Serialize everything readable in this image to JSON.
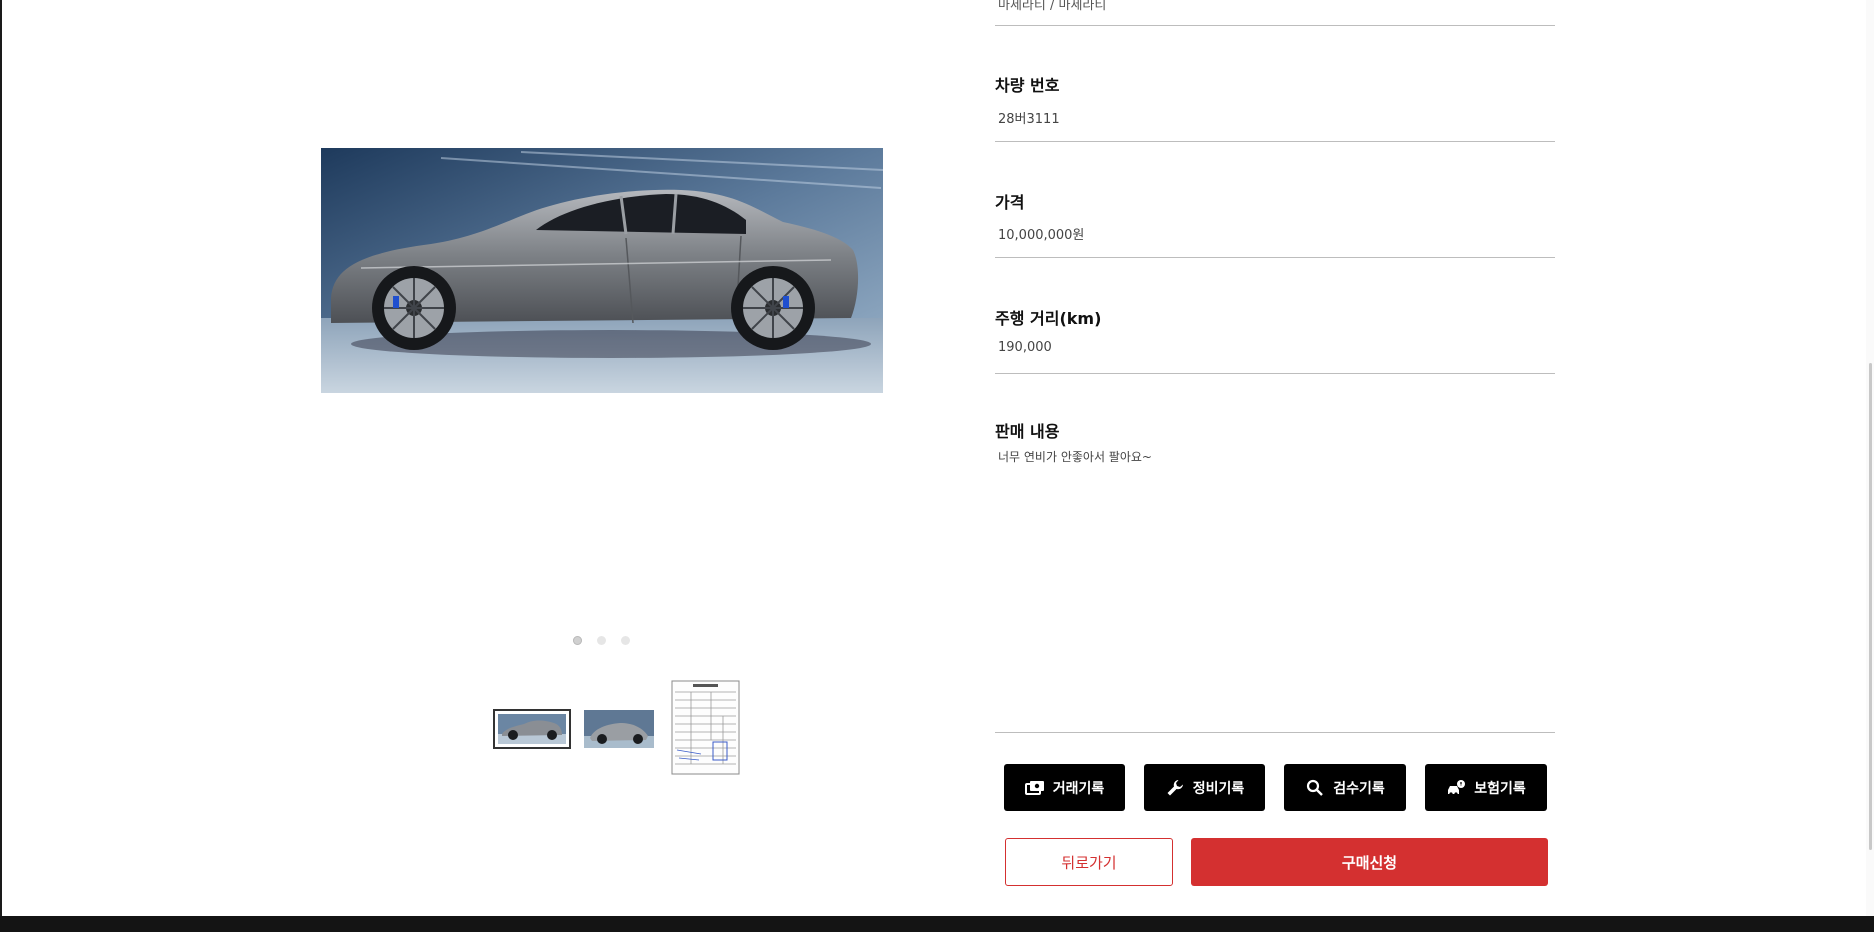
{
  "details": {
    "previous_value": "마세라티 / 마세라티",
    "fields": [
      {
        "label": "차량 번호",
        "value": "28버3111"
      },
      {
        "label": "가격",
        "value": "10,000,000원"
      },
      {
        "label": "주행 거리(km)",
        "value": "190,000"
      }
    ],
    "description_label": "판매 내용",
    "description_text": "너무 연비가 안좋아서 팔아요~"
  },
  "carousel": {
    "slide_count": 3,
    "active_index": 0,
    "thumbnails": [
      {
        "name": "car-side-thumbnail",
        "selected": true
      },
      {
        "name": "car-front-thumbnail",
        "selected": false
      },
      {
        "name": "registration-document-thumbnail",
        "selected": false
      }
    ]
  },
  "record_buttons": [
    {
      "label": "거래기록",
      "icon": "money-icon"
    },
    {
      "label": "정비기록",
      "icon": "wrench-icon"
    },
    {
      "label": "검수기록",
      "icon": "search-icon"
    },
    {
      "label": "보험기록",
      "icon": "insurance-icon"
    }
  ],
  "actions": {
    "back_label": "뒤로가기",
    "buy_label": "구매신청"
  },
  "colors": {
    "accent": "#d43030",
    "button_dark": "#000000",
    "divider": "#bdbdbd"
  }
}
